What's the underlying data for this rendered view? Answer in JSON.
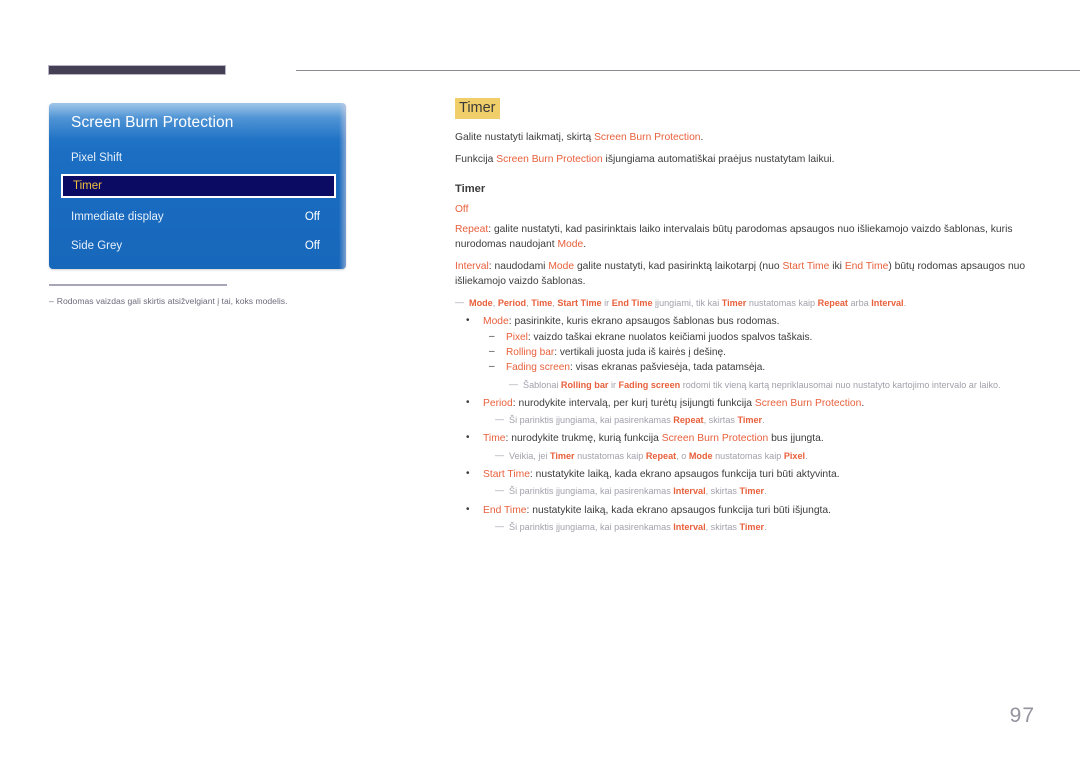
{
  "colors": {
    "accent_keyword": "#e8603c",
    "heading_highlight": "#f0cf6b",
    "note_grey": "#a3a0ab",
    "osd_blue": "#1b6ec2",
    "osd_selected_bg": "#0b0b63",
    "osd_selected_text": "#f0c040",
    "tab_bar": "#453f55",
    "page_number": "#95939e"
  },
  "osd": {
    "title": "Screen Burn Protection",
    "rows": [
      {
        "label": "Pixel Shift",
        "value": ""
      },
      {
        "label": "Timer",
        "value": "",
        "selected": true
      },
      {
        "label": "Immediate display",
        "value": "Off"
      },
      {
        "label": "Side Grey",
        "value": "Off"
      }
    ]
  },
  "left_note": {
    "dash": "–",
    "text": "Rodomas vaizdas gali skirtis atsižvelgiant į tai, koks modelis."
  },
  "content": {
    "heading": "Timer",
    "intro": [
      {
        "segments": [
          {
            "t": "Galite nustatyti laikmatį, skirtą ",
            "s": "plain"
          },
          {
            "t": "Screen Burn Protection",
            "s": "kw"
          },
          {
            "t": ".",
            "s": "plain"
          }
        ]
      },
      {
        "segments": [
          {
            "t": "Funkcija ",
            "s": "plain"
          },
          {
            "t": "Screen Burn Protection",
            "s": "kw"
          },
          {
            "t": " išjungiama automatiškai praėjus nustatytam laikui.",
            "s": "plain"
          }
        ]
      }
    ],
    "sub_heading": "Timer",
    "off_label": "Off",
    "paragraphs": [
      {
        "segments": [
          {
            "t": "Repeat",
            "s": "kw"
          },
          {
            "t": ": galite nustatyti, kad pasirinktais laiko intervalais būtų parodomas apsaugos nuo išliekamojo vaizdo šablonas, kuris nurodomas naudojant ",
            "s": "plain"
          },
          {
            "t": "Mode",
            "s": "kw"
          },
          {
            "t": ".",
            "s": "plain"
          }
        ]
      },
      {
        "segments": [
          {
            "t": "Interval",
            "s": "kw"
          },
          {
            "t": ": naudodami ",
            "s": "plain"
          },
          {
            "t": "Mode",
            "s": "kw"
          },
          {
            "t": " galite nustatyti, kad pasirinktą laikotarpį (nuo ",
            "s": "plain"
          },
          {
            "t": "Start Time",
            "s": "kw"
          },
          {
            "t": " iki ",
            "s": "plain"
          },
          {
            "t": "End Time",
            "s": "kw"
          },
          {
            "t": ") būtų rodomas apsaugos nuo išliekamojo vaizdo šablonas.",
            "s": "plain"
          }
        ]
      }
    ],
    "note_top": {
      "dash": "―",
      "segments": [
        {
          "t": "Mode",
          "s": "kwb"
        },
        {
          "t": ", ",
          "s": "grey"
        },
        {
          "t": "Period",
          "s": "kwb"
        },
        {
          "t": ", ",
          "s": "grey"
        },
        {
          "t": "Time",
          "s": "kwb"
        },
        {
          "t": ", ",
          "s": "grey"
        },
        {
          "t": "Start Time",
          "s": "kwb"
        },
        {
          "t": " ir ",
          "s": "grey"
        },
        {
          "t": "End Time",
          "s": "kwb"
        },
        {
          "t": " įjungiami, tik kai ",
          "s": "grey"
        },
        {
          "t": "Timer",
          "s": "kwb"
        },
        {
          "t": " nustatomas kaip ",
          "s": "grey"
        },
        {
          "t": "Repeat",
          "s": "kwb"
        },
        {
          "t": " arba ",
          "s": "grey"
        },
        {
          "t": "Interval",
          "s": "kwb"
        },
        {
          "t": ".",
          "s": "grey"
        }
      ]
    },
    "bullets": [
      {
        "bullet": "•",
        "segments": [
          {
            "t": "Mode",
            "s": "kw"
          },
          {
            "t": ": pasirinkite, kuris ekrano apsaugos šablonas bus rodomas.",
            "s": "plain"
          }
        ],
        "sub": [
          {
            "dash": "–",
            "segments": [
              {
                "t": "Pixel",
                "s": "kw"
              },
              {
                "t": ": vaizdo taškai ekrane nuolatos keičiami juodos spalvos taškais.",
                "s": "plain"
              }
            ]
          },
          {
            "dash": "–",
            "segments": [
              {
                "t": "Rolling bar",
                "s": "kw"
              },
              {
                "t": ": vertikali juosta juda iš kairės į dešinę.",
                "s": "plain"
              }
            ]
          },
          {
            "dash": "–",
            "segments": [
              {
                "t": "Fading screen",
                "s": "kw"
              },
              {
                "t": ": visas ekranas pašviesėja, tada patamsėja.",
                "s": "plain"
              }
            ]
          }
        ],
        "note": {
          "dash": "―",
          "indent": 2,
          "segments": [
            {
              "t": "Šablonai ",
              "s": "grey"
            },
            {
              "t": "Rolling bar",
              "s": "kwb"
            },
            {
              "t": " ir ",
              "s": "grey"
            },
            {
              "t": "Fading screen",
              "s": "kwb"
            },
            {
              "t": " rodomi tik vieną kartą nepriklausomai nuo nustatyto kartojimo intervalo ar laiko.",
              "s": "grey"
            }
          ]
        }
      },
      {
        "bullet": "•",
        "segments": [
          {
            "t": "Period",
            "s": "kw"
          },
          {
            "t": ": nurodykite intervalą, per kurį turėtų įsijungti funkcija ",
            "s": "plain"
          },
          {
            "t": "Screen Burn Protection",
            "s": "kw"
          },
          {
            "t": ".",
            "s": "plain"
          }
        ],
        "note": {
          "dash": "―",
          "indent": 1,
          "segments": [
            {
              "t": "Ši parinktis įjungiama, kai pasirenkamas ",
              "s": "grey"
            },
            {
              "t": "Repeat",
              "s": "kwb"
            },
            {
              "t": ", skirtas ",
              "s": "grey"
            },
            {
              "t": "Timer",
              "s": "kwb"
            },
            {
              "t": ".",
              "s": "grey"
            }
          ]
        }
      },
      {
        "bullet": "•",
        "segments": [
          {
            "t": "Time",
            "s": "kw"
          },
          {
            "t": ": nurodykite trukmę, kurią funkcija ",
            "s": "plain"
          },
          {
            "t": "Screen Burn Protection",
            "s": "kw"
          },
          {
            "t": " bus įjungta.",
            "s": "plain"
          }
        ],
        "note": {
          "dash": "―",
          "indent": 1,
          "segments": [
            {
              "t": "Veikia, jei ",
              "s": "grey"
            },
            {
              "t": "Timer",
              "s": "kwb"
            },
            {
              "t": " nustatomas kaip ",
              "s": "grey"
            },
            {
              "t": "Repeat",
              "s": "kwb"
            },
            {
              "t": ", o ",
              "s": "grey"
            },
            {
              "t": "Mode",
              "s": "kwb"
            },
            {
              "t": " nustatomas kaip ",
              "s": "grey"
            },
            {
              "t": "Pixel",
              "s": "kwb"
            },
            {
              "t": ".",
              "s": "grey"
            }
          ]
        }
      },
      {
        "bullet": "•",
        "segments": [
          {
            "t": "Start Time",
            "s": "kw"
          },
          {
            "t": ": nustatykite laiką, kada ekrano apsaugos funkcija turi būti aktyvinta.",
            "s": "plain"
          }
        ],
        "note": {
          "dash": "―",
          "indent": 1,
          "segments": [
            {
              "t": "Ši parinktis įjungiama, kai pasirenkamas ",
              "s": "grey"
            },
            {
              "t": "Interval",
              "s": "kwb"
            },
            {
              "t": ", skirtas ",
              "s": "grey"
            },
            {
              "t": "Timer",
              "s": "kwb"
            },
            {
              "t": ".",
              "s": "grey"
            }
          ]
        }
      },
      {
        "bullet": "•",
        "segments": [
          {
            "t": "End Time",
            "s": "kw"
          },
          {
            "t": ": nustatykite laiką, kada ekrano apsaugos funkcija turi būti išjungta.",
            "s": "plain"
          }
        ],
        "note": {
          "dash": "―",
          "indent": 1,
          "segments": [
            {
              "t": "Ši parinktis įjungiama, kai pasirenkamas ",
              "s": "grey"
            },
            {
              "t": "Interval",
              "s": "kwb"
            },
            {
              "t": ", skirtas ",
              "s": "grey"
            },
            {
              "t": "Timer",
              "s": "kwb"
            },
            {
              "t": ".",
              "s": "grey"
            }
          ]
        }
      }
    ]
  },
  "page_number": "97"
}
